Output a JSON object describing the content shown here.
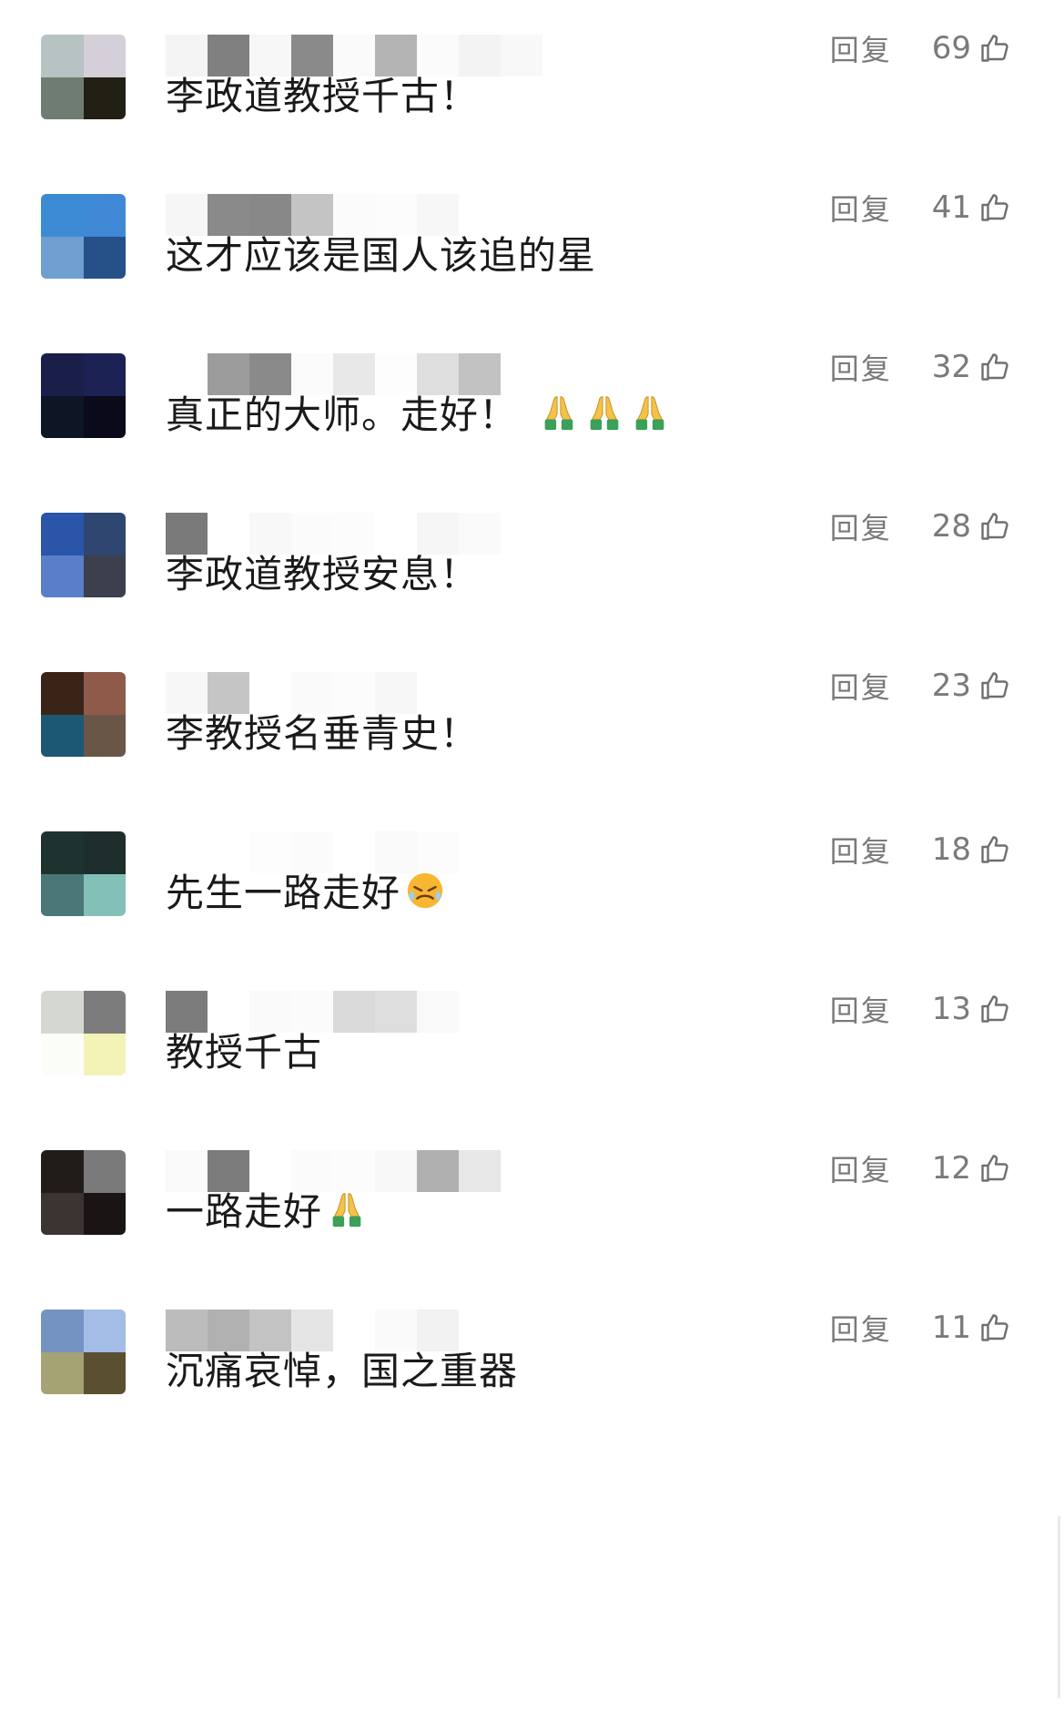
{
  "comments": [
    {
      "text": "李政道教授千古！",
      "reply_label": "回复",
      "likes": "69",
      "avatar_colors": [
        "#b7c2c3",
        "#d4cfd8",
        "#6f7c72",
        "#222015"
      ],
      "name_blocks": [
        "#f4f4f4",
        "#808080",
        "#f7f7f7",
        "#8a8a8a",
        "#fafafa",
        "#b4b4b4",
        "#fbfbfb",
        "#f3f3f3",
        "#f8f8f8"
      ],
      "emoji": []
    },
    {
      "text": "这才应该是国人该追的星",
      "reply_label": "回复",
      "likes": "41",
      "avatar_colors": [
        "#3d8ad4",
        "#3f88d6",
        "#6e9fd0",
        "#255088"
      ],
      "name_blocks": [
        "#f6f6f6",
        "#8a8a8a",
        "#888888",
        "#c4c4c4",
        "#fbfbfb",
        "#fcfcfc",
        "#f7f7f7"
      ],
      "emoji": []
    },
    {
      "text": "真正的大师。走好！",
      "reply_label": "回复",
      "likes": "32",
      "avatar_colors": [
        "#1a1f4a",
        "#1c2254",
        "#0e1626",
        "#0a0a1a"
      ],
      "name_blocks": [
        "#ffffff",
        "#9c9c9c",
        "#8a8a8a",
        "#fbfbfb",
        "#e8e8e8",
        "#fdfdfd",
        "#dedede",
        "#c2c2c2"
      ],
      "emoji": [
        "pray",
        "pray",
        "pray"
      ]
    },
    {
      "text": "李政道教授安息！",
      "reply_label": "回复",
      "likes": "28",
      "avatar_colors": [
        "#2a55a8",
        "#2e4670",
        "#5a7ec9",
        "#3b3f4e"
      ],
      "name_blocks": [
        "#7a7a7a",
        "#ffffff",
        "#f8f8f8",
        "#fbfbfb",
        "#fcfcfc",
        "#ffffff",
        "#f6f6f6",
        "#fafafa"
      ],
      "emoji": []
    },
    {
      "text": "李教授名垂青史！",
      "reply_label": "回复",
      "likes": "23",
      "avatar_colors": [
        "#3a2418",
        "#8e5b4a",
        "#1c5874",
        "#6a5647"
      ],
      "name_blocks": [
        "#f7f7f7",
        "#c5c5c5",
        "#ffffff",
        "#fafafa",
        "#fcfcfc",
        "#f7f7f7"
      ],
      "emoji": []
    },
    {
      "text": "先生一路走好",
      "reply_label": "回复",
      "likes": "18",
      "avatar_colors": [
        "#1e3330",
        "#1d2e2c",
        "#4a7878",
        "#82c0b8"
      ],
      "name_blocks": [
        "#ffffff",
        "#ffffff",
        "#fdfdfd",
        "#fbfbfb",
        "#ffffff",
        "#f9f9f9",
        "#fcfcfc"
      ],
      "emoji": [
        "tears-face"
      ]
    },
    {
      "text": "教授千古",
      "reply_label": "回复",
      "likes": "13",
      "avatar_colors": [
        "#d5d8d2",
        "#7c7c7c",
        "#fbfdf9",
        "#f3f3b8"
      ],
      "name_blocks": [
        "#7c7c7c",
        "#ffffff",
        "#fafafa",
        "#fbfbfb",
        "#dadada",
        "#dedede",
        "#f9f9f9"
      ],
      "emoji": []
    },
    {
      "text": "一路走好",
      "reply_label": "回复",
      "likes": "12",
      "avatar_colors": [
        "#211c1a",
        "#7a7a7a",
        "#3b3433",
        "#1a1514"
      ],
      "name_blocks": [
        "#f9f9f9",
        "#7b7b7b",
        "#ffffff",
        "#fbfbfb",
        "#fcfcfc",
        "#f8f8f8",
        "#b0b0b0",
        "#e7e7e7"
      ],
      "emoji": [
        "pray"
      ]
    },
    {
      "text": "沉痛哀悼，国之重器",
      "reply_label": "回复",
      "likes": "11",
      "avatar_colors": [
        "#7593c2",
        "#a3bde7",
        "#a5a273",
        "#5a4f31"
      ],
      "name_blocks": [
        "#bcbcbc",
        "#b1b1b1",
        "#c3c3c3",
        "#e5e5e5",
        "#ffffff",
        "#fafafa",
        "#f2f2f2"
      ],
      "emoji": []
    }
  ],
  "icons": {
    "like": "thumbs-up-outline-icon",
    "pray": "folded-hands-emoji-icon",
    "tears-face": "tears-face-emoji-icon"
  },
  "colors": {
    "text": "#1a1a1a",
    "meta": "#7a7a7a",
    "background": "#ffffff"
  }
}
